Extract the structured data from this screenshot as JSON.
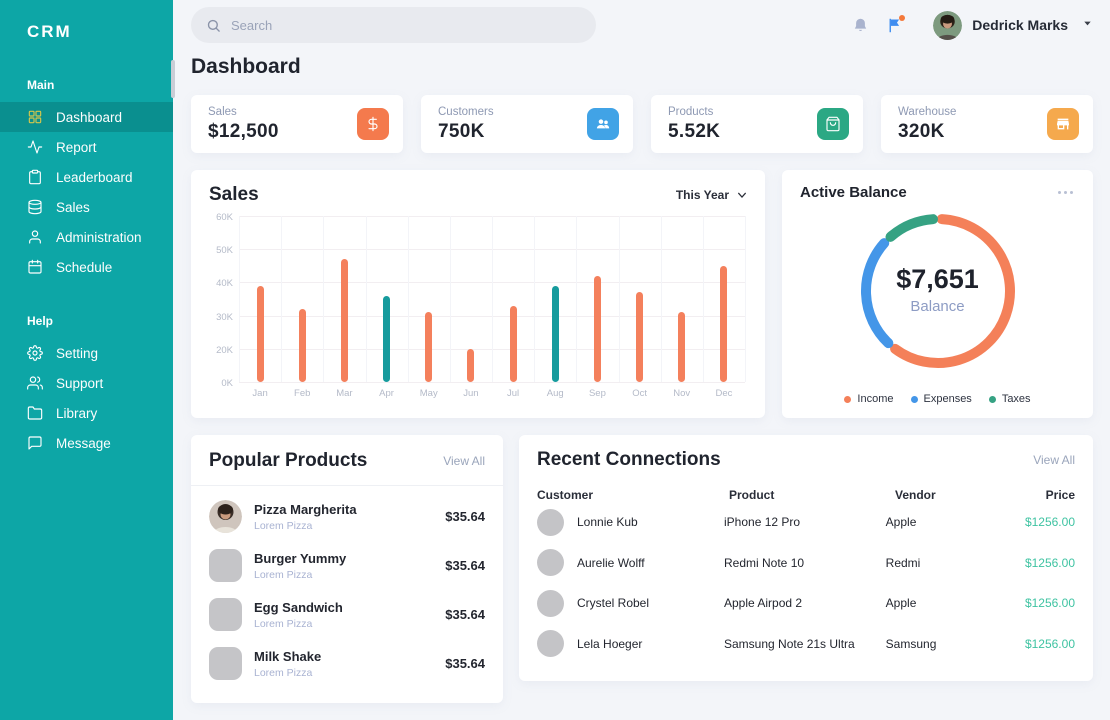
{
  "app": {
    "logo": "CRM"
  },
  "sidebar": {
    "sections": [
      {
        "label": "Main",
        "items": [
          {
            "label": "Dashboard",
            "icon": "dashboard-icon",
            "active": true
          },
          {
            "label": "Report",
            "icon": "report-icon",
            "active": false
          },
          {
            "label": "Leaderboard",
            "icon": "leaderboard-icon",
            "active": false
          },
          {
            "label": "Sales",
            "icon": "sales-icon",
            "active": false
          },
          {
            "label": "Administration",
            "icon": "administration-icon",
            "active": false
          },
          {
            "label": "Schedule",
            "icon": "schedule-icon",
            "active": false
          }
        ]
      },
      {
        "label": "Help",
        "items": [
          {
            "label": "Setting",
            "icon": "setting-icon",
            "active": false
          },
          {
            "label": "Support",
            "icon": "support-icon",
            "active": false
          },
          {
            "label": "Library",
            "icon": "library-icon",
            "active": false
          },
          {
            "label": "Message",
            "icon": "message-icon",
            "active": false
          }
        ]
      }
    ]
  },
  "topbar": {
    "search_placeholder": "Search",
    "user_name": "Dedrick Marks"
  },
  "page": {
    "title": "Dashboard"
  },
  "stats": [
    {
      "label": "Sales",
      "value": "$12,500",
      "icon": "dollar-icon",
      "icon_bg": "#f47a4d"
    },
    {
      "label": "Customers",
      "value": "750K",
      "icon": "customers-icon",
      "icon_bg": "#41a3e6"
    },
    {
      "label": "Products",
      "value": "5.52K",
      "icon": "products-icon",
      "icon_bg": "#2ba884"
    },
    {
      "label": "Warehouse",
      "value": "320K",
      "icon": "warehouse-icon",
      "icon_bg": "#f5a94d"
    }
  ],
  "chart_data": [
    {
      "type": "bar",
      "title": "Sales",
      "range_selector": "This Year",
      "categories": [
        "Jan",
        "Feb",
        "Mar",
        "Apr",
        "May",
        "Jun",
        "Jul",
        "Aug",
        "Sep",
        "Oct",
        "Nov",
        "Dec"
      ],
      "values": [
        39,
        32,
        47,
        36,
        31,
        20,
        33,
        39,
        42,
        37,
        31,
        45
      ],
      "unit": "K",
      "highlight_indices": [
        3,
        7
      ],
      "bar_color_default": "#f4805c",
      "bar_color_highlight": "#169b9d",
      "ytick_values": [
        0,
        20,
        30,
        40,
        50,
        60
      ],
      "ytick_labels_top_to_bottom": [
        "60K",
        "50K",
        "40K",
        "30K",
        "20K",
        "0K"
      ],
      "grid": true
    },
    {
      "type": "donut",
      "title": "Active Balance",
      "center_value": "$7,651",
      "center_label": "Balance",
      "segments": [
        {
          "name": "Income",
          "percent": 63,
          "color": "#f48059"
        },
        {
          "name": "Expenses",
          "percent": 26,
          "color": "#4496e8"
        },
        {
          "name": "Taxes",
          "percent": 11,
          "color": "#36a283"
        }
      ],
      "legend_position": "bottom"
    }
  ],
  "popular_products": {
    "title": "Popular Products",
    "view_all_label": "View All",
    "items": [
      {
        "name": "Pizza Margherita",
        "subtitle": "Lorem Pizza",
        "price": "$35.64",
        "thumb": "photo"
      },
      {
        "name": "Burger Yummy",
        "subtitle": "Lorem Pizza",
        "price": "$35.64",
        "thumb": "placeholder"
      },
      {
        "name": "Egg Sandwich",
        "subtitle": "Lorem Pizza",
        "price": "$35.64",
        "thumb": "placeholder"
      },
      {
        "name": "Milk Shake",
        "subtitle": "Lorem Pizza",
        "price": "$35.64",
        "thumb": "placeholder"
      }
    ]
  },
  "recent_connections": {
    "title": "Recent Connections",
    "view_all_label": "View All",
    "columns": [
      "Customer",
      "Product",
      "Vendor",
      "Price"
    ],
    "rows": [
      {
        "customer": "Lonnie Kub",
        "product": "iPhone 12 Pro",
        "vendor": "Apple",
        "price": "$1256.00"
      },
      {
        "customer": "Aurelie Wolff",
        "product": "Redmi Note 10",
        "vendor": "Redmi",
        "price": "$1256.00"
      },
      {
        "customer": "Crystel Robel",
        "product": "Apple Airpod 2",
        "vendor": "Apple",
        "price": "$1256.00"
      },
      {
        "customer": "Lela Hoeger",
        "product": "Samsung Note 21s Ultra",
        "vendor": "Samsung",
        "price": "$1256.00"
      }
    ],
    "price_color": "#3fc3a2"
  },
  "colors": {
    "sidebar": "#0da6a6",
    "sidebar_active_icon": "#d6c74c",
    "page_bg": "#f3f5f9",
    "text_dark": "#20242e",
    "text_muted": "#8e99b3"
  }
}
